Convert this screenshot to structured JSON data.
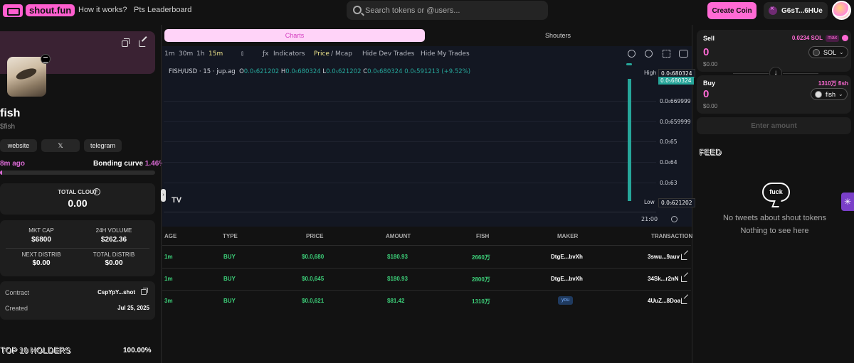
{
  "nav": {
    "logo_text": "shout.fun",
    "links": [
      "How it works?",
      "Pts Leaderboard"
    ],
    "search_placeholder": "Search tokens or @users...",
    "create_label": "Create Coin",
    "wallet_label": "G6sT...6HUe"
  },
  "token": {
    "name": "fish",
    "ticker": "$fish",
    "socials": [
      "website",
      "𝕏",
      "telegram"
    ],
    "age": "8m ago",
    "bonding_label": "Bonding curve",
    "bonding_pct": "1.46%",
    "bonding_fraction": 0.0146,
    "total_clout_label": "TOTAL CLOUT",
    "total_clout": "0.00",
    "stats": [
      {
        "label": "MKT CAP",
        "value": "$6800"
      },
      {
        "label": "24H VOLUME",
        "value": "$262.36"
      },
      {
        "label": "NEXT DISTRIB",
        "value": "$0.00"
      },
      {
        "label": "TOTAL DISTRIB",
        "value": "$0.00"
      }
    ],
    "contract_label": "Contract",
    "contract_value": "CspYpY...shot",
    "created_label": "Created",
    "created_value": "Jul 25, 2025",
    "holders_title": "TOP 10 HOLDERS",
    "holders_pct": "100.00%"
  },
  "tabs": {
    "charts": "Charts",
    "shouters": "Shouters"
  },
  "chart_toolbar": {
    "intervals": [
      "1m",
      "30m",
      "1h",
      "15m"
    ],
    "indicators": "Indicators",
    "price_label": "Price",
    "mcap_label": "Mcap",
    "hide_dev": "Hide Dev Trades",
    "hide_my": "Hide My Trades"
  },
  "chart_data": {
    "type": "candlestick",
    "symbol": "FISH/USD · 15 · jup.ag",
    "ohlc": {
      "o_label": "O",
      "o": "0.0₅621202",
      "h_label": "H",
      "h": "0.0₅680324",
      "l_label": "L",
      "l": "0.0₅621202",
      "c_label": "C",
      "c": "0.0₅680324",
      "change": "0.0₅591213 (+9.52%)"
    },
    "y_ticks": [
      "0.0₅680324",
      "0.0₅680324",
      "0.0₅669999",
      "0.0₅659999",
      "0.0₅65",
      "0.0₅64",
      "0.0₅63",
      "0.0₅621202"
    ],
    "high_label": "High",
    "low_label": "Low",
    "x_tick": "21:00",
    "candles": [
      {
        "time": "21:00",
        "open": 6.21202e-06,
        "high": 6.80324e-06,
        "low": 6.21202e-06,
        "close": 6.80324e-06
      }
    ]
  },
  "trades": {
    "headers": [
      "AGE",
      "TYPE",
      "PRICE",
      "AMOUNT",
      "FISH",
      "MAKER",
      "TRANSACTION"
    ],
    "rows": [
      {
        "age": "1m",
        "type": "BUY",
        "price": "$0.0,680",
        "amount": "$180.93",
        "fish": "2660万",
        "maker": "DtgE...bvXh",
        "tx": "3swu...9auv"
      },
      {
        "age": "1m",
        "type": "BUY",
        "price": "$0.0,645",
        "amount": "$180.93",
        "fish": "2800万",
        "maker": "DtgE...bvXh",
        "tx": "34Sk...r2nN"
      },
      {
        "age": "3m",
        "type": "BUY",
        "price": "$0.0,621",
        "amount": "$81.42",
        "fish": "1310万",
        "maker": "you",
        "tx": "4UuZ...8Doa"
      }
    ]
  },
  "trade_panel": {
    "sell_label": "Sell",
    "sell_balance": "0.0234 SOL",
    "max_label": "max",
    "sell_amount": "0",
    "sell_usd": "$0.00",
    "sell_token": "SOL",
    "buy_label": "Buy",
    "buy_balance": "1310万 fish",
    "buy_amount": "0",
    "buy_usd": "$0.00",
    "buy_token": "fish",
    "enter_label": "Enter amount"
  },
  "feed": {
    "title": "FEED",
    "bubble_text": "fuck",
    "empty1": "No tweets about shout tokens",
    "empty2": "Nothing to see here"
  }
}
